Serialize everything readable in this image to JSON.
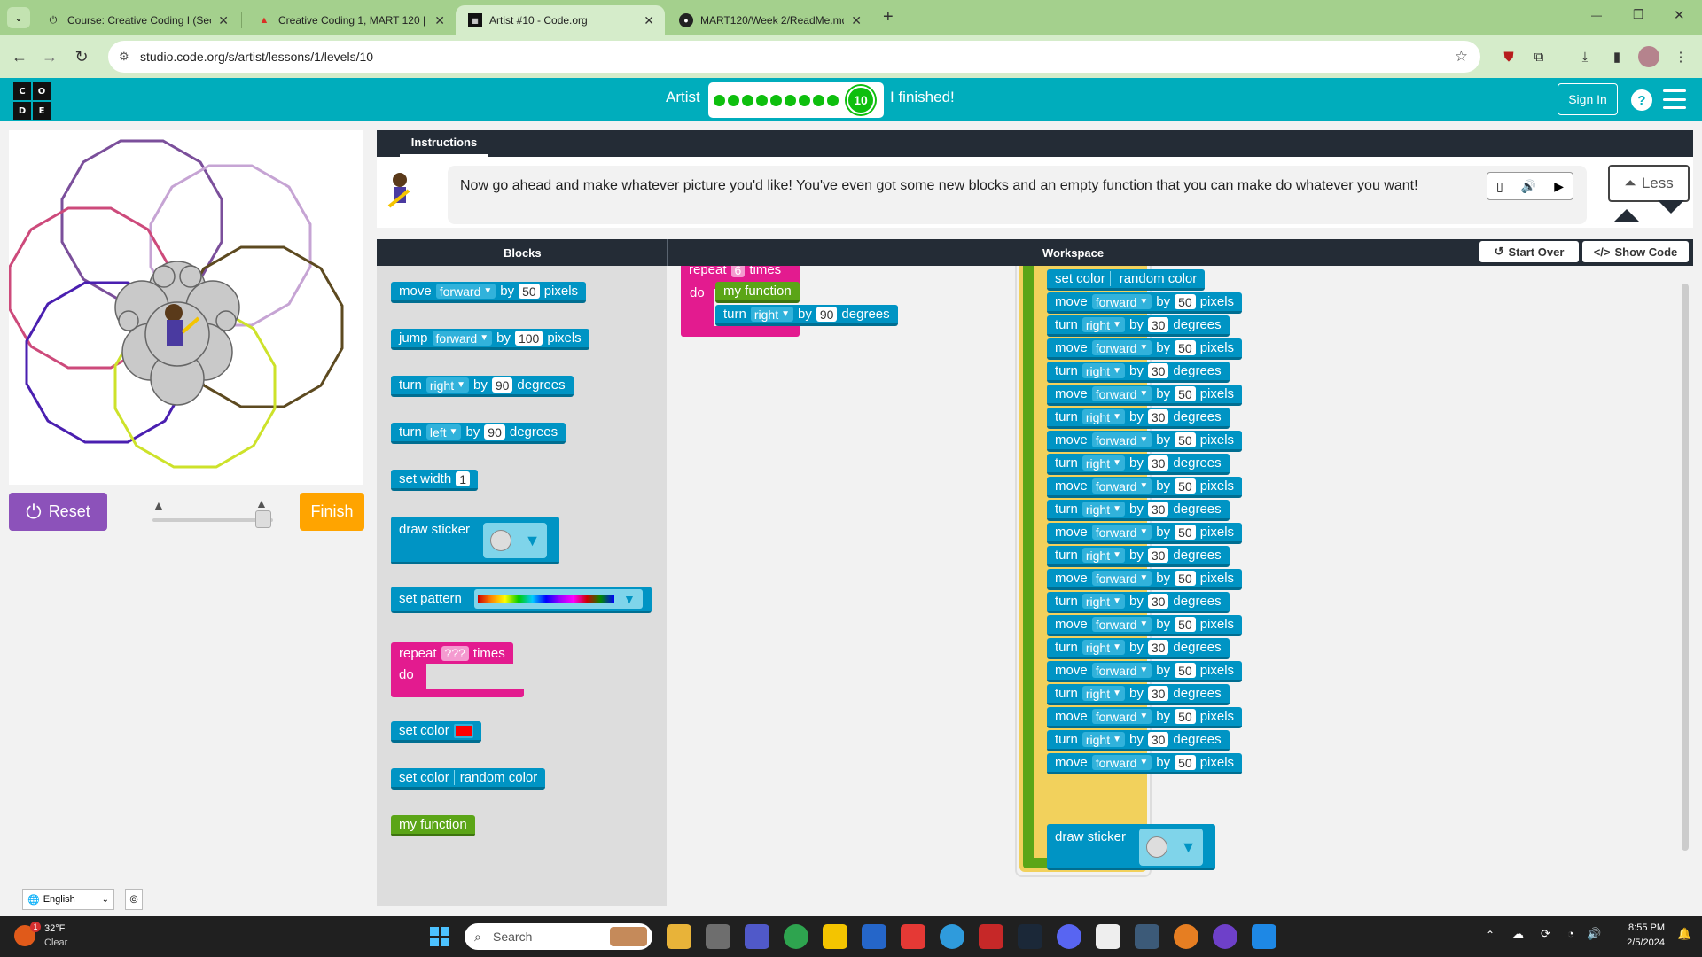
{
  "browser": {
    "tabs": [
      {
        "title": "Course: Creative Coding I (Sect",
        "icon": "moodle-icon",
        "active": false
      },
      {
        "title": "Creative Coding 1, MART 120 |",
        "icon": "drive-icon",
        "active": false
      },
      {
        "title": "Artist #10 - Code.org",
        "icon": "code-org-icon",
        "active": true
      },
      {
        "title": "MART120/Week 2/ReadMe.md",
        "icon": "github-icon",
        "active": false
      }
    ],
    "new_tab": "+",
    "url": "studio.code.org/s/artist/lessons/1/levels/10",
    "window_controls": [
      "—",
      "❐",
      "✕"
    ]
  },
  "header": {
    "logo_letters": [
      "C",
      "O",
      "D",
      "E"
    ],
    "level_title": "Artist",
    "progress_dots": 9,
    "current_level": "10",
    "finished_text": "I finished!",
    "sign_in": "Sign In",
    "help": "?"
  },
  "stage": {
    "reset": "Reset",
    "finish": "Finish",
    "speed_level": 1.0,
    "language": "English",
    "copyright": "©",
    "colors": {
      "purple": "#7b4f9b",
      "lilac": "#c6a4d4",
      "rose": "#cd4a7b",
      "olive": "#5d4a20",
      "indigo": "#4a1fb0",
      "lime": "#cde22a"
    }
  },
  "instructions": {
    "tab": "Instructions",
    "text": "Now go ahead and make whatever picture you'd like! You've even got some new blocks and an empty function that you can make do whatever you want!",
    "less": "Less"
  },
  "panels": {
    "blocks_header": "Blocks",
    "workspace_header": "Workspace",
    "start_over": "Start Over",
    "show_code": "Show Code"
  },
  "toolbox": {
    "move": {
      "label": "move",
      "dir": "forward",
      "by": "by",
      "value": "50",
      "unit": "pixels"
    },
    "jump": {
      "label": "jump",
      "dir": "forward",
      "by": "by",
      "value": "100",
      "unit": "pixels"
    },
    "turn_right": {
      "label": "turn",
      "dir": "right",
      "by": "by",
      "value": "90",
      "unit": "degrees"
    },
    "turn_left": {
      "label": "turn",
      "dir": "left",
      "by": "by",
      "value": "90",
      "unit": "degrees"
    },
    "set_width": {
      "label": "set width",
      "value": "1"
    },
    "draw_sticker": {
      "label": "draw sticker"
    },
    "set_pattern": {
      "label": "set pattern"
    },
    "repeat": {
      "label": "repeat",
      "value": "???",
      "unit": "times",
      "do": "do"
    },
    "set_color": {
      "label": "set color",
      "color": "#ff0000"
    },
    "set_color_random": {
      "label": "set color",
      "value": "random color"
    },
    "my_function": {
      "label": "my function"
    }
  },
  "workspace": {
    "repeat": {
      "label": "repeat",
      "value": "6",
      "unit": "times",
      "do": "do"
    },
    "call_function": "my function",
    "turn": {
      "label": "turn",
      "dir": "right",
      "by": "by",
      "value": "90",
      "unit": "degrees"
    },
    "set_color": {
      "label": "set color",
      "value": "random color"
    },
    "move": {
      "label": "move",
      "dir": "forward",
      "by": "by",
      "value": "50",
      "unit": "pixels"
    },
    "turn_inner": {
      "label": "turn",
      "dir": "right",
      "by": "by",
      "value": "30",
      "unit": "degrees"
    },
    "draw_sticker": "draw sticker"
  },
  "taskbar": {
    "weather_temp": "32°F",
    "weather_desc": "Clear",
    "weather_badge": "1",
    "search": "Search",
    "time": "8:55 PM",
    "date": "2/5/2024"
  }
}
